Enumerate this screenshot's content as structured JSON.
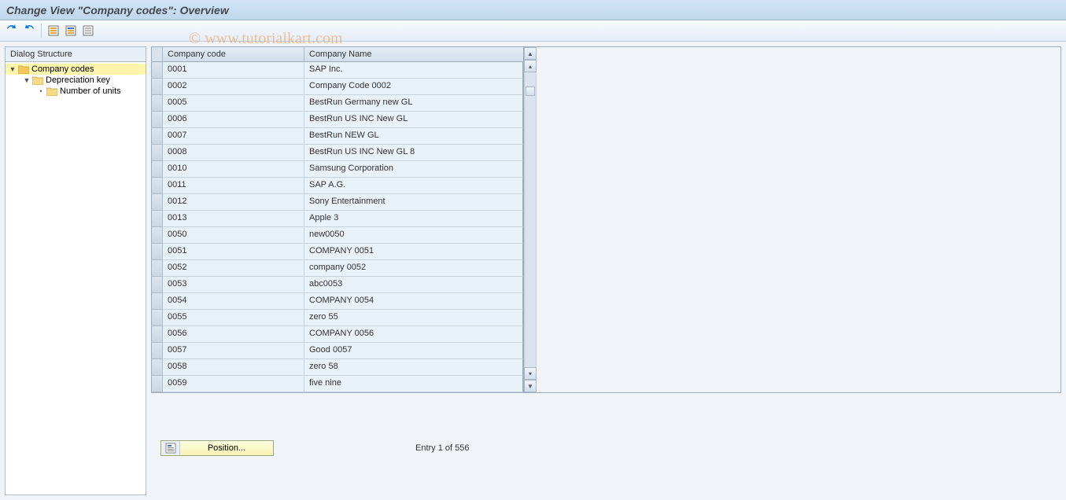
{
  "title": "Change View \"Company codes\": Overview",
  "watermark": "© www.tutorialkart.com",
  "tree": {
    "header": "Dialog Structure",
    "items": [
      {
        "label": "Company codes",
        "level": 0,
        "open": true,
        "selected": true,
        "leaf": false
      },
      {
        "label": "Depreciation key",
        "level": 1,
        "open": true,
        "selected": false,
        "leaf": false
      },
      {
        "label": "Number of units",
        "level": 2,
        "open": false,
        "selected": false,
        "leaf": true
      }
    ]
  },
  "table": {
    "columns": {
      "code": "Company code",
      "name": "Company Name"
    },
    "rows": [
      {
        "code": "0001",
        "name": "SAP Inc."
      },
      {
        "code": "0002",
        "name": "Company Code 0002"
      },
      {
        "code": "0005",
        "name": "BestRun Germany new GL"
      },
      {
        "code": "0006",
        "name": "BestRun US INC New GL"
      },
      {
        "code": "0007",
        "name": "BestRun NEW GL"
      },
      {
        "code": "0008",
        "name": "BestRun US INC New GL 8"
      },
      {
        "code": "0010",
        "name": "Samsung Corporation"
      },
      {
        "code": "0011",
        "name": "SAP A.G."
      },
      {
        "code": "0012",
        "name": "Sony Entertainment"
      },
      {
        "code": "0013",
        "name": "Apple 3"
      },
      {
        "code": "0050",
        "name": "new0050"
      },
      {
        "code": "0051",
        "name": "COMPANY 0051"
      },
      {
        "code": "0052",
        "name": "company 0052"
      },
      {
        "code": "0053",
        "name": "abc0053"
      },
      {
        "code": "0054",
        "name": "COMPANY 0054"
      },
      {
        "code": "0055",
        "name": "zero 55"
      },
      {
        "code": "0056",
        "name": "COMPANY 0056"
      },
      {
        "code": "0057",
        "name": "Good 0057"
      },
      {
        "code": "0058",
        "name": "zero 58"
      },
      {
        "code": "0059",
        "name": "five nine"
      }
    ]
  },
  "footer": {
    "position_label": "Position...",
    "entry_text": "Entry 1 of 556"
  }
}
